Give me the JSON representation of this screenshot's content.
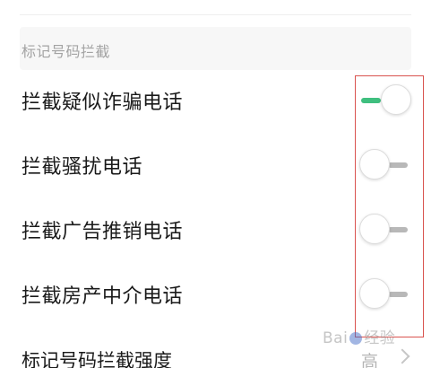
{
  "section": {
    "title": "标记号码拦截"
  },
  "rows": [
    {
      "label": "拦截疑似诈骗电话",
      "toggle_on": true
    },
    {
      "label": "拦截骚扰电话",
      "toggle_on": false
    },
    {
      "label": "拦截广告推销电话",
      "toggle_on": false
    },
    {
      "label": "拦截房产中介电话",
      "toggle_on": false
    }
  ],
  "intensity": {
    "label": "标记号码拦截强度",
    "value": "高"
  },
  "watermark": {
    "text_left": "Bai",
    "text_right": "经验"
  },
  "colors": {
    "toggle_on_track": "#3fbf7f",
    "toggle_off_track": "#b8b8b8",
    "annotation_outline": "#d9534f"
  }
}
